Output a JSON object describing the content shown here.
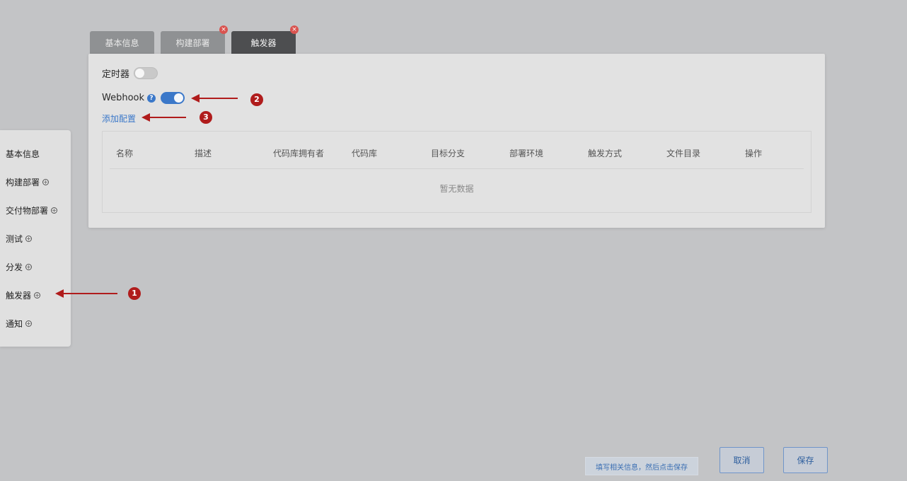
{
  "tabs": [
    {
      "label": "基本信息",
      "active": false,
      "closable": false
    },
    {
      "label": "构建部署",
      "active": false,
      "closable": true
    },
    {
      "label": "触发器",
      "active": true,
      "closable": true
    }
  ],
  "trigger_panel": {
    "timer_label": "定时器",
    "timer_enabled": false,
    "webhook_label": "Webhook",
    "webhook_enabled": true,
    "help_icon": "?",
    "add_config_label": "添加配置",
    "table": {
      "columns": [
        "名称",
        "描述",
        "代码库拥有者",
        "代码库",
        "目标分支",
        "部署环境",
        "触发方式",
        "文件目录",
        "操作"
      ],
      "empty_text": "暂无数据"
    }
  },
  "side_nav": [
    {
      "label": "基本信息",
      "has_add": false
    },
    {
      "label": "构建部署",
      "has_add": true
    },
    {
      "label": "交付物部署",
      "has_add": true
    },
    {
      "label": "测试",
      "has_add": true
    },
    {
      "label": "分发",
      "has_add": true
    },
    {
      "label": "触发器",
      "has_add": true
    },
    {
      "label": "通知",
      "has_add": true
    }
  ],
  "annotations": [
    "1",
    "2",
    "3"
  ],
  "footer": {
    "hint": "填写相关信息，然后点击保存",
    "cancel_label": "取消",
    "save_label": "保存"
  },
  "colors": {
    "accent": "#3b78c9",
    "annotation": "#b01c1c",
    "active_tab": "#4d4e50"
  }
}
